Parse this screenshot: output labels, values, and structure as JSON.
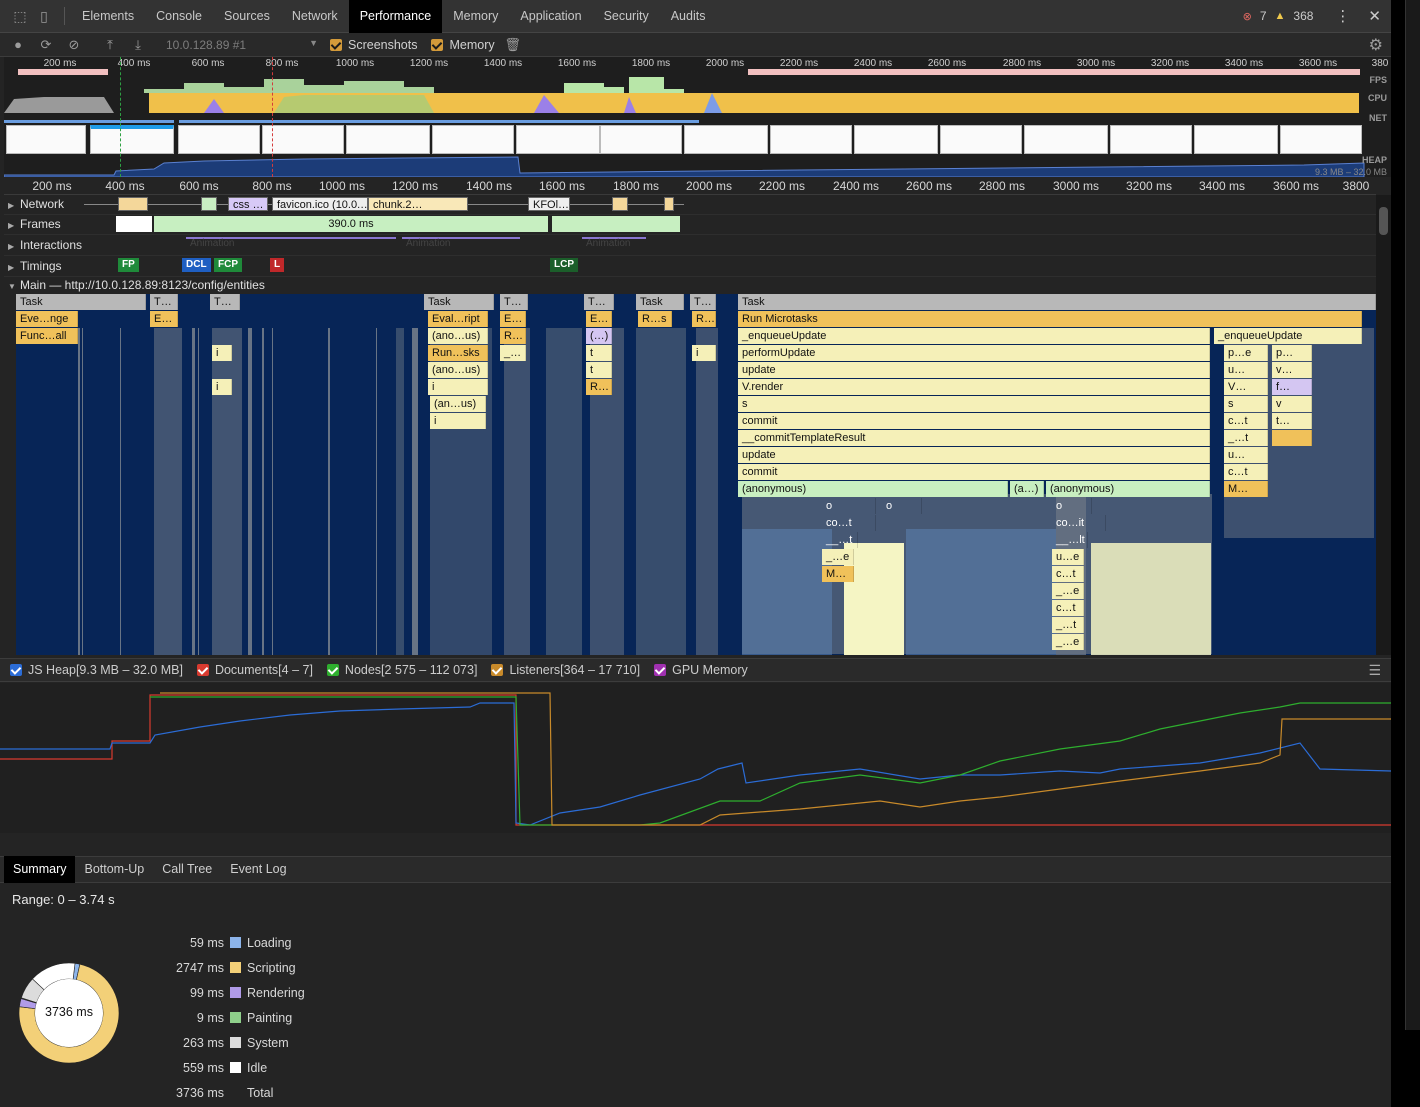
{
  "tabs": [
    "Elements",
    "Console",
    "Sources",
    "Network",
    "Performance",
    "Memory",
    "Application",
    "Security",
    "Audits"
  ],
  "active_tab": "Performance",
  "status": {
    "errors": "7",
    "warnings": "368"
  },
  "toolbar": {
    "profile_select": "10.0.128.89 #1",
    "screenshots_label": "Screenshots",
    "memory_label": "Memory"
  },
  "overview": {
    "ticks": [
      "200 ms",
      "400 ms",
      "600 ms",
      "800 ms",
      "1000 ms",
      "1200 ms",
      "1400 ms",
      "1600 ms",
      "1800 ms",
      "2000 ms",
      "2200 ms",
      "2400 ms",
      "2600 ms",
      "2800 ms",
      "3000 ms",
      "3200 ms",
      "3400 ms",
      "3600 ms",
      "380"
    ],
    "fps_label": "FPS",
    "cpu_label": "CPU",
    "net_label": "NET",
    "heap_label": "HEAP",
    "heap_range": "9.3 MB – 32.0 MB"
  },
  "ruler": [
    "200 ms",
    "400 ms",
    "600 ms",
    "800 ms",
    "1000 ms",
    "1200 ms",
    "1400 ms",
    "1600 ms",
    "1800 ms",
    "2000 ms",
    "2200 ms",
    "2400 ms",
    "2600 ms",
    "2800 ms",
    "3000 ms",
    "3200 ms",
    "3400 ms",
    "3600 ms",
    "3800"
  ],
  "tracks": {
    "network": "Network",
    "frames": "Frames",
    "interactions": "Interactions",
    "timings": "Timings",
    "main": "Main — http://10.0.128.89:8123/config/entities",
    "network_items": [
      "css …",
      "favicon.ico (10.0.…",
      "chunk.2…",
      "KFOl…"
    ],
    "frame_label": "390.0 ms",
    "animation_label": "Animation",
    "timing_markers": [
      "FP",
      "DCL",
      "FCP",
      "L",
      "LCP"
    ]
  },
  "flame": {
    "labels": [
      "Task",
      "T…",
      "T…",
      "Task",
      "T…",
      "T…",
      "Task",
      "T…",
      "Task",
      "Eve…nge",
      "E…",
      "Eval…ript",
      "E…",
      "E…",
      "R…s",
      "R…",
      "Run Microtasks",
      "Func…all",
      "(ano…us)",
      "R…",
      "(…)",
      "_enqueueUpdate",
      "_enqueueUpdate",
      "i",
      "Run…sks",
      "_…",
      "t",
      "i",
      "performUpdate",
      "p…e",
      "p…",
      "(ano…us)",
      "t",
      "update",
      "u…",
      "v…",
      "i",
      "i",
      "R…",
      "V.render",
      "V…",
      "f…",
      "(an…us)",
      "s",
      "s",
      "v",
      "i",
      "commit",
      "c…t",
      "t…",
      "__commitTemplateResult",
      "_…t",
      "update",
      "u…",
      "commit",
      "c…t",
      "(anonymous)",
      "(a…)",
      "(anonymous)",
      "M…",
      "o",
      "o",
      "o",
      "co…t",
      "co…it",
      "__…t",
      "__…lt",
      "_…e",
      "u…e",
      "M…",
      "c…t",
      "_…e",
      "c…t",
      "_…t",
      "_…e"
    ]
  },
  "counters": [
    {
      "label": "JS Heap[9.3 MB – 32.0 MB]",
      "color": "#2b6cd6"
    },
    {
      "label": "Documents[4 – 7]",
      "color": "#d83a2f"
    },
    {
      "label": "Nodes[2 575 – 112 073]",
      "color": "#2eae2e"
    },
    {
      "label": "Listeners[364 – 17 710]",
      "color": "#c88a2a"
    },
    {
      "label": "GPU Memory",
      "color": "#a030b0"
    }
  ],
  "bottom_tabs": [
    "Summary",
    "Bottom-Up",
    "Call Tree",
    "Event Log"
  ],
  "summary": {
    "range": "Range: 0 – 3.74 s",
    "total_center": "3736 ms",
    "rows": [
      {
        "value": "59 ms",
        "label": "Loading",
        "color": "#8cb4ea"
      },
      {
        "value": "2747 ms",
        "label": "Scripting",
        "color": "#f3d078"
      },
      {
        "value": "99 ms",
        "label": "Rendering",
        "color": "#b09be8"
      },
      {
        "value": "9 ms",
        "label": "Painting",
        "color": "#8fd08b"
      },
      {
        "value": "263 ms",
        "label": "System",
        "color": "#dcdcdc"
      },
      {
        "value": "559 ms",
        "label": "Idle",
        "color": "#ffffff"
      },
      {
        "value": "3736 ms",
        "label": "Total",
        "color": ""
      }
    ]
  }
}
